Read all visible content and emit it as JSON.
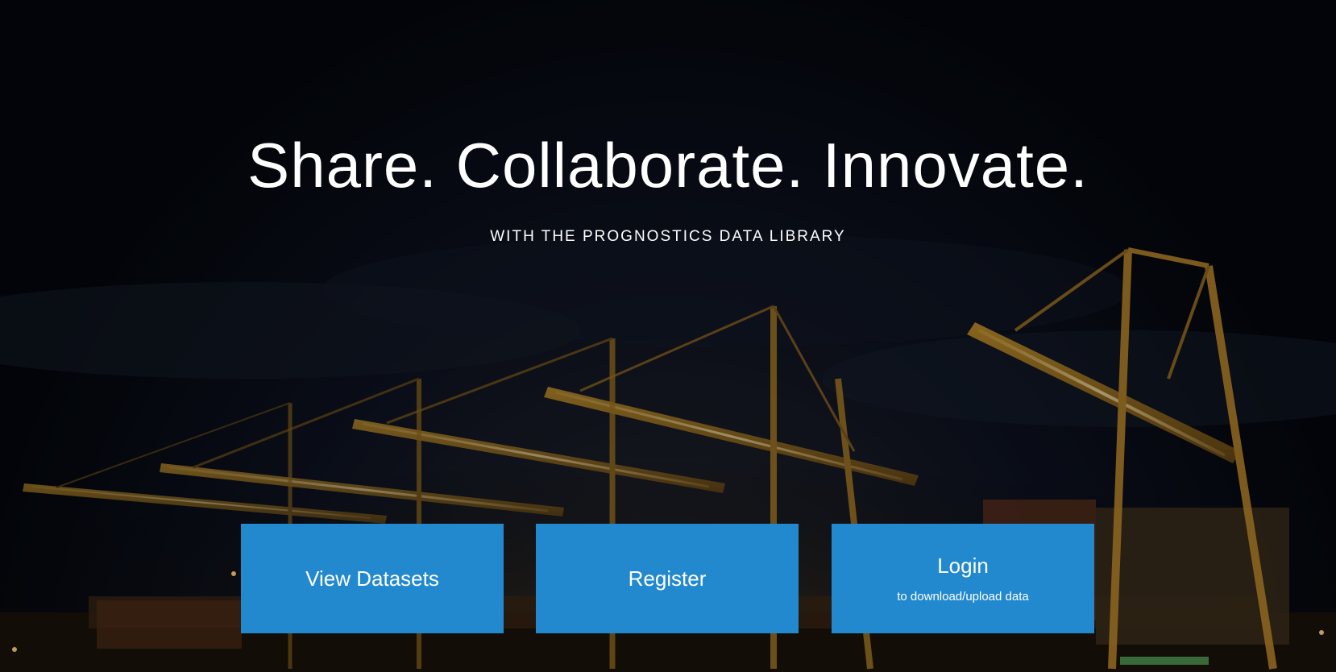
{
  "hero": {
    "headline": "Share. Collaborate. Innovate.",
    "subheadline": "WITH THE PROGNOSTICS DATA LIBRARY"
  },
  "buttons": {
    "view_datasets": {
      "label": "View Datasets"
    },
    "register": {
      "label": "Register"
    },
    "login": {
      "label": "Login",
      "sublabel": "to download/upload data"
    }
  },
  "colors": {
    "button_bg": "#2289cf",
    "text": "#ffffff",
    "background": "#05060c"
  },
  "background_image": "night-port-container-cranes"
}
